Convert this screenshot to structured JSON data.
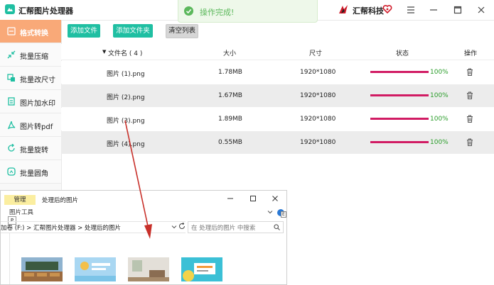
{
  "app": {
    "title": "汇帮图片处理器",
    "brand": "汇帮科技"
  },
  "toast": {
    "text": "操作完成!"
  },
  "sidebar": {
    "items": [
      {
        "label": "格式转换",
        "icon": "convert-icon",
        "active": true
      },
      {
        "label": "批量压缩",
        "icon": "compress-icon"
      },
      {
        "label": "批量改尺寸",
        "icon": "resize-icon"
      },
      {
        "label": "图片加水印",
        "icon": "watermark-icon"
      },
      {
        "label": "图片转pdf",
        "icon": "pdf-icon"
      },
      {
        "label": "批量旋转",
        "icon": "rotate-icon"
      },
      {
        "label": "批量圆角",
        "icon": "rounded-corner-icon"
      }
    ]
  },
  "toolbar": {
    "add_file": "添加文件",
    "add_folder": "添加文件夹",
    "clear_list": "清空列表"
  },
  "table": {
    "headers": {
      "filename": "文件名 ( 4 )",
      "size": "大小",
      "dimensions": "尺寸",
      "status": "状态",
      "actions": "操作"
    },
    "rows": [
      {
        "name": "图片 (1).png",
        "size": "1.78MB",
        "dims": "1920*1080",
        "progress": 100,
        "pct": "100%"
      },
      {
        "name": "图片 (2).png",
        "size": "1.67MB",
        "dims": "1920*1080",
        "progress": 100,
        "pct": "100%"
      },
      {
        "name": "图片 (3).png",
        "size": "1.89MB",
        "dims": "1920*1080",
        "progress": 100,
        "pct": "100%"
      },
      {
        "name": "图片 (4).png",
        "size": "0.55MB",
        "dims": "1920*1080",
        "progress": 100,
        "pct": "100%"
      }
    ]
  },
  "explorer": {
    "manage": "管理",
    "title": "处理后的图片",
    "tools": "图片工具",
    "p_key": "P",
    "e_key": "E",
    "path": "加卷 (F:)  >  汇帮图片处理器  >  处理后的图片",
    "search_placeholder": "在 处理后的图片 中搜索"
  },
  "colors": {
    "accent_green": "#1fbfa2",
    "active_orange": "#f9a978",
    "progress_pink": "#d11b63",
    "success_green": "#5cb85c"
  }
}
